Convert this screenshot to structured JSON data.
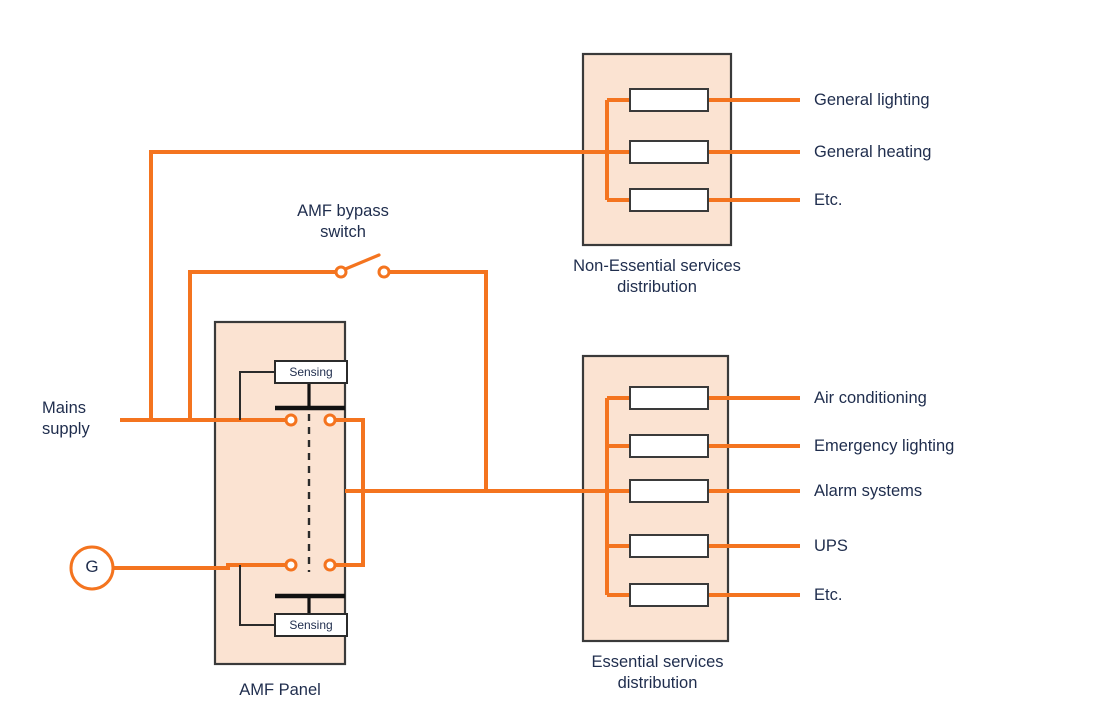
{
  "diagram": {
    "title": "AMF Panel distribution schematic",
    "colors": {
      "wire": "#f4741f",
      "panel_fill": "#fbe3d2",
      "panel_stroke": "#3a3a3a",
      "text": "#1f2d4d",
      "fuse_fill": "#ffffff"
    },
    "sources": {
      "mains": {
        "label": "Mains\nsupply",
        "line1": "Mains",
        "line2": "supply"
      },
      "generator": {
        "symbol": "G",
        "name": "generator-symbol"
      }
    },
    "amf_panel": {
      "label": "AMF Panel",
      "sensing_top": "Sensing",
      "sensing_bottom": "Sensing"
    },
    "bypass_switch": {
      "label": "AMF bypass\nswitch",
      "line1": "AMF bypass",
      "line2": "switch",
      "state": "open"
    },
    "non_essential": {
      "label": "Non-Essential services\ndistribution",
      "line1": "Non-Essential services",
      "line2": "distribution",
      "outputs": [
        {
          "label": "General lighting"
        },
        {
          "label": "General heating"
        },
        {
          "label": "Etc."
        }
      ]
    },
    "essential": {
      "label": "Essential services\ndistribution",
      "line1": "Essential services",
      "line2": "distribution",
      "outputs": [
        {
          "label": "Air conditioning"
        },
        {
          "label": "Emergency lighting"
        },
        {
          "label": "Alarm systems"
        },
        {
          "label": "UPS"
        },
        {
          "label": "Etc."
        }
      ]
    }
  }
}
